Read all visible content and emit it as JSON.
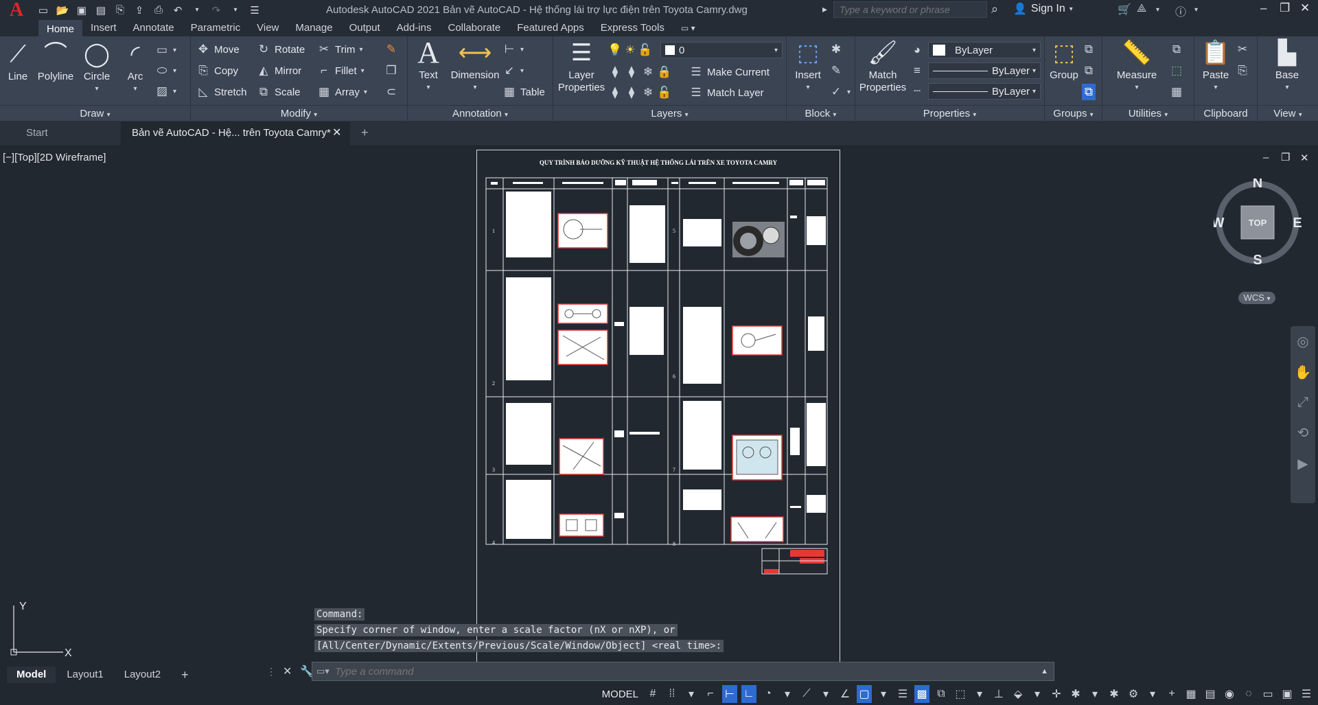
{
  "app": {
    "logo": "A",
    "window_title": "Autodesk AutoCAD 2021   Bản vẽ AutoCAD - Hệ thống lái trợ lực điện trên Toyota Camry.dwg",
    "search_placeholder": "Type a keyword or phrase",
    "sign_in": "Sign In"
  },
  "tabs": [
    "Home",
    "Insert",
    "Annotate",
    "Parametric",
    "View",
    "Manage",
    "Output",
    "Add-ins",
    "Collaborate",
    "Featured Apps",
    "Express Tools"
  ],
  "ribbon": {
    "draw": {
      "title": "Draw",
      "line": "Line",
      "polyline": "Polyline",
      "circle": "Circle",
      "arc": "Arc"
    },
    "modify": {
      "title": "Modify",
      "move": "Move",
      "rotate": "Rotate",
      "trim": "Trim",
      "copy": "Copy",
      "mirror": "Mirror",
      "fillet": "Fillet",
      "stretch": "Stretch",
      "scale": "Scale",
      "array": "Array"
    },
    "annotation": {
      "title": "Annotation",
      "text": "Text",
      "dimension": "Dimension",
      "table": "Table"
    },
    "layers": {
      "title": "Layers",
      "layer_properties_1": "Layer",
      "layer_properties_2": "Properties",
      "current_layer": "0",
      "make_current": "Make Current",
      "match_layer": "Match Layer"
    },
    "block": {
      "title": "Block",
      "insert": "Insert"
    },
    "properties": {
      "title": "Properties",
      "match_1": "Match",
      "match_2": "Properties",
      "color": "ByLayer",
      "linetype": "ByLayer",
      "lineweight": "ByLayer"
    },
    "groups": {
      "title": "Groups",
      "group": "Group"
    },
    "utilities": {
      "title": "Utilities",
      "measure": "Measure"
    },
    "clipboard": {
      "title": "Clipboard",
      "paste": "Paste"
    },
    "view": {
      "title": "View",
      "base": "Base"
    }
  },
  "doc_tabs": {
    "start": "Start",
    "active": "Bản vẽ AutoCAD - Hệ... trên Toyota Camry*"
  },
  "viewport": {
    "label": "[−][Top][2D Wireframe]",
    "sheet_title": "QUY TRÌNH BẢO DƯỠNG KỸ THUẬT HỆ THỐNG LÁI TRÊN XE TOYOTA CAMRY",
    "rows_left": [
      "1",
      "2",
      "3",
      "4"
    ],
    "rows_right": [
      "5",
      "6",
      "7",
      "8"
    ],
    "compass": {
      "n": "N",
      "s": "S",
      "e": "E",
      "w": "W",
      "top": "TOP"
    },
    "wcs": "WCS",
    "ucs_x": "X",
    "ucs_y": "Y"
  },
  "command": {
    "history": [
      "Command:",
      "Specify corner of window, enter a scale factor (nX or nXP), or",
      "[All/Center/Dynamic/Extents/Previous/Scale/Window/Object] <real time>:"
    ],
    "placeholder": "Type a command"
  },
  "layout_tabs": [
    "Model",
    "Layout1",
    "Layout2"
  ],
  "status": {
    "model": "MODEL"
  }
}
